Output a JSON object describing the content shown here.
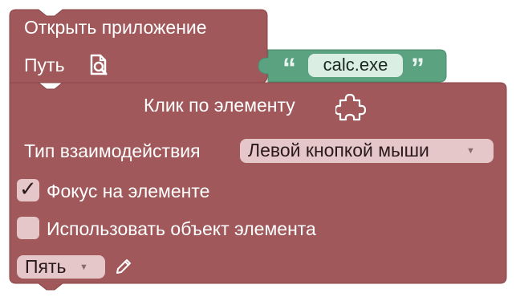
{
  "colors": {
    "block_red": "#a0585b",
    "block_red_dark": "#8a4649",
    "block_green": "#5ba281",
    "field_light": "#e6c7c9",
    "text_field_light": "#dbeee3"
  },
  "open_app_block": {
    "title": "Открыть приложение",
    "path_label": "Путь",
    "path_icon": "file-search-icon"
  },
  "text_block": {
    "open_quote": "“",
    "value": "calc.exe",
    "close_quote": "”"
  },
  "click_block": {
    "title": "Клик по элементу",
    "title_icon": "puzzle-icon",
    "interaction_label": "Тип взаимодействия",
    "interaction_value": "Левой кнопкой мыши",
    "focus_label": "Фокус на элементе",
    "focus_checked": true,
    "use_object_label": "Использовать объект элемента",
    "use_object_checked": false,
    "variable_value": "Пять",
    "edit_icon": "pencil-icon",
    "dropdown_arrow": "▼"
  }
}
